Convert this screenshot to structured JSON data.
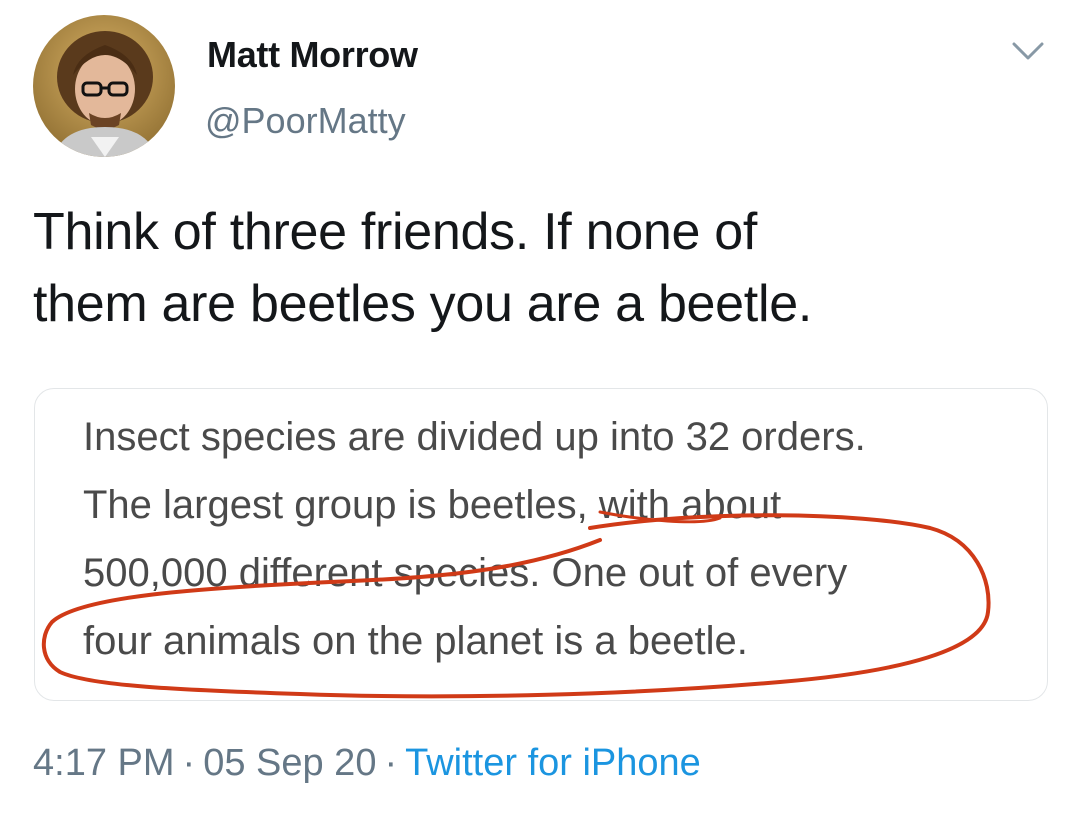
{
  "author": {
    "name": "Matt Morrow",
    "handle": "@PoorMatty"
  },
  "tweet": {
    "lines": [
      "Think of three friends.  If none of",
      "them are beetles you are a beetle."
    ]
  },
  "quoted_card": {
    "lines": [
      "Insect species are divided up into 32 orders.",
      "The largest group is beetles, with about",
      "500,000 different species. One out of every",
      "four animals on the planet is a beetle."
    ],
    "annotation_color": "#d03a17"
  },
  "meta": {
    "time": "4:17 PM",
    "date": "05 Sep 20",
    "separator": "·",
    "source": "Twitter for iPhone"
  },
  "colors": {
    "text": "#14171a",
    "secondary": "#657786",
    "link": "#1b95e0"
  },
  "icons": [
    "avatar-photo",
    "chevron-down-icon"
  ]
}
